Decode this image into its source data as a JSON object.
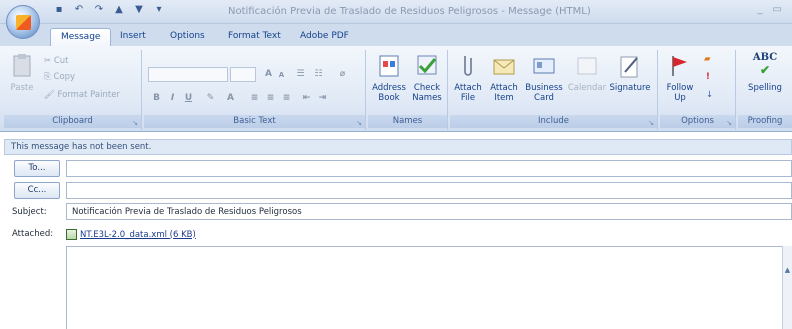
{
  "window": {
    "title": "Notificación Previa de Traslado de Residuos Peligrosos - Message (HTML)",
    "min_glyph": "_",
    "restore_glyph": "▭"
  },
  "tabs": [
    "Message",
    "Insert",
    "Options",
    "Format Text",
    "Adobe PDF"
  ],
  "ribbon": {
    "clipboard": {
      "paste": "Paste",
      "cut": "Cut",
      "copy": "Copy",
      "format_painter": "Format Painter",
      "label": "Clipboard"
    },
    "basic_text": {
      "label": "Basic Text",
      "bold": "B",
      "italic": "I",
      "underline": "U",
      "grow": "A",
      "shrink": "A"
    },
    "names": {
      "address_book": "Address Book",
      "check_names": "Check Names",
      "label": "Names"
    },
    "include": {
      "attach_file": "Attach File",
      "attach_item": "Attach Item",
      "business_card": "Business Card",
      "calendar": "Calendar",
      "signature": "Signature",
      "label": "Include"
    },
    "options": {
      "follow_up": "Follow Up",
      "label": "Options"
    },
    "proofing": {
      "spelling": "Spelling",
      "abc": "ABC",
      "label": "Proofing"
    }
  },
  "message": {
    "info": "This message has not been sent.",
    "to_label": "To...",
    "cc_label": "Cc...",
    "subject_label": "Subject:",
    "subject_value": "Notificación Previa de Traslado de Residuos Peligrosos",
    "attached_label": "Attached:",
    "attachment": "NT.E3L-2.0_data.xml (6 KB)"
  }
}
